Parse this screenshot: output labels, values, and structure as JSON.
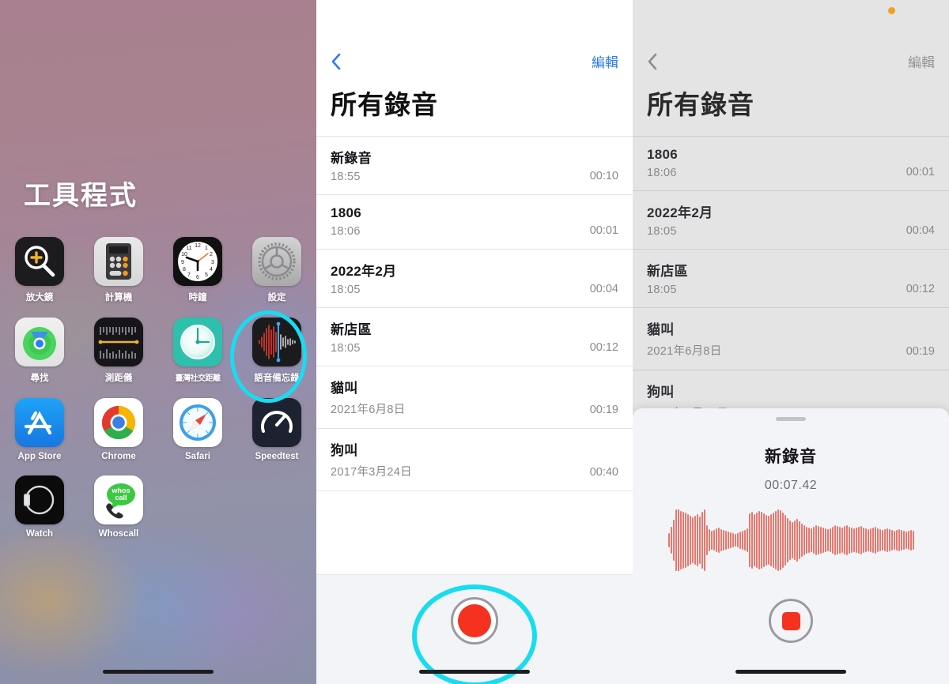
{
  "home": {
    "folder_title": "工具程式",
    "apps": [
      {
        "label": "放大鏡",
        "icon": "magnifier-icon"
      },
      {
        "label": "計算機",
        "icon": "calculator-icon"
      },
      {
        "label": "時鐘",
        "icon": "clock-icon"
      },
      {
        "label": "設定",
        "icon": "settings-gear-icon"
      },
      {
        "label": "尋找",
        "icon": "find-my-icon"
      },
      {
        "label": "測距儀",
        "icon": "measure-icon"
      },
      {
        "label": "臺灣社交距離",
        "icon": "social-distance-icon"
      },
      {
        "label": "語音備忘錄",
        "icon": "voice-memos-icon"
      },
      {
        "label": "App Store",
        "icon": "app-store-icon"
      },
      {
        "label": "Chrome",
        "icon": "chrome-icon"
      },
      {
        "label": "Safari",
        "icon": "safari-compass-icon"
      },
      {
        "label": "Speedtest",
        "icon": "speedtest-gauge-icon"
      },
      {
        "label": "Watch",
        "icon": "watch-icon"
      },
      {
        "label": "Whoscall",
        "icon": "whoscall-icon"
      }
    ],
    "highlight_target": "語音備忘錄"
  },
  "voice_memos_list": {
    "back_label": "‹",
    "edit_label": "編輯",
    "title": "所有錄音",
    "recordings": [
      {
        "name": "新錄音",
        "date": "18:55",
        "duration": "00:10"
      },
      {
        "name": "1806",
        "date": "18:06",
        "duration": "00:01"
      },
      {
        "name": "2022年2月",
        "date": "18:05",
        "duration": "00:04"
      },
      {
        "name": "新店區",
        "date": "18:05",
        "duration": "00:12"
      },
      {
        "name": "貓叫",
        "date": "2021年6月8日",
        "duration": "00:19"
      },
      {
        "name": "狗叫",
        "date": "2017年3月24日",
        "duration": "00:40"
      }
    ],
    "record_button_label": "錄音"
  },
  "voice_memos_recording": {
    "back_label": "‹",
    "edit_label": "編輯",
    "title": "所有錄音",
    "recordings": [
      {
        "name": "1806",
        "date": "18:06",
        "duration": "00:01"
      },
      {
        "name": "2022年2月",
        "date": "18:05",
        "duration": "00:04"
      },
      {
        "name": "新店區",
        "date": "18:05",
        "duration": "00:12"
      },
      {
        "name": "貓叫",
        "date": "2021年6月8日",
        "duration": "00:19"
      },
      {
        "name": "狗叫",
        "date": "2017年3月24日",
        "duration": "00:40"
      }
    ],
    "sheet": {
      "title": "新錄音",
      "timer": "00:07.42",
      "stop_button_label": "停止",
      "waveform_amplitudes": [
        18,
        34,
        52,
        78,
        80,
        74,
        72,
        70,
        66,
        62,
        58,
        62,
        66,
        60,
        72,
        78,
        38,
        28,
        24,
        26,
        30,
        32,
        28,
        26,
        24,
        22,
        20,
        18,
        16,
        18,
        22,
        24,
        26,
        30,
        68,
        72,
        66,
        70,
        74,
        72,
        68,
        64,
        62,
        66,
        70,
        74,
        78,
        76,
        70,
        64,
        56,
        50,
        46,
        50,
        54,
        48,
        42,
        38,
        34,
        32,
        30,
        34,
        38,
        36,
        34,
        32,
        30,
        28,
        30,
        34,
        38,
        36,
        34,
        32,
        36,
        38,
        34,
        32,
        30,
        32,
        34,
        36,
        32,
        30,
        28,
        30,
        32,
        34,
        30,
        28,
        26,
        28,
        30,
        28,
        26,
        24,
        26,
        28,
        26,
        24,
        22,
        24,
        26,
        24
      ]
    },
    "recording_indicator": "orange-dot"
  },
  "colors": {
    "accent_blue": "#2e7dea",
    "record_red": "#f5311f",
    "highlight_cyan": "#18dcf0",
    "waveform_red": "#e4796f",
    "recording_dot_orange": "#f0a21c"
  }
}
